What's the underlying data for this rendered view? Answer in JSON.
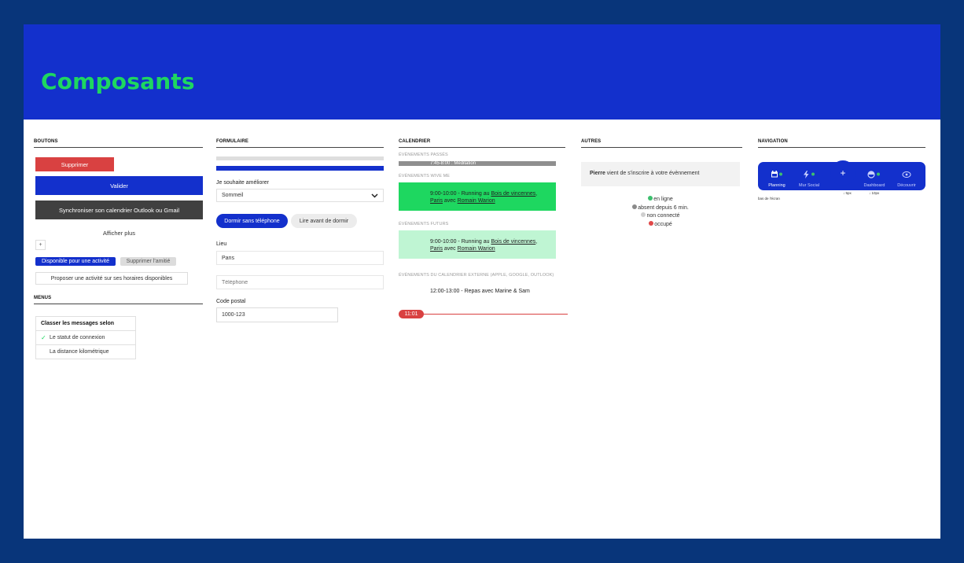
{
  "header": {
    "title": "Composants"
  },
  "colors": {
    "background": "#08357a",
    "hero": "#1330cc",
    "accent_green": "#1ed760",
    "danger": "#d94141",
    "primary": "#1330cc",
    "dark": "#404040"
  },
  "boutons": {
    "title": "BOUTONS",
    "delete": "Supprimer",
    "validate": "Valider",
    "sync": "Synchroniser son calendrier Outlook ou Gmail",
    "show_more": "Afficher plus",
    "plus": "+",
    "tag_available": "Disponible pour une activité",
    "tag_remove_friend": "Supprimer l'amitié",
    "propose": "Proposer une activité sur ses horaires disponibles"
  },
  "menus": {
    "title": "MENUS",
    "header": "Classer les messages selon",
    "items": [
      {
        "label": "Le statut de connexion",
        "checked": true
      },
      {
        "label": "La distance kilométrique",
        "checked": false
      }
    ]
  },
  "formulaire": {
    "title": "FORMULAIRE",
    "select_label": "Je souhaite améliorer",
    "select_value": "Sommeil",
    "pill_active": "Dormir sans téléphone",
    "pill_inactive": "Lire avant de dormir",
    "lieu_label": "Lieu",
    "lieu_value": "Paris",
    "phone_placeholder": "Téléphone",
    "postal_label": "Code postal",
    "postal_value": "1000-123",
    "progress": 1.0
  },
  "calendrier": {
    "title": "CALENDRIER",
    "past_label": "ÉVÉNEMENTS PASSÉS",
    "past_event": "7:45-8:00 : Méditation",
    "vive_label": "ÉVÉNEMENTS WIVE ME",
    "vive_event": {
      "time": "9:00-10:00 - Running au ",
      "place": "Bois de vincennes",
      "sep1": ",",
      "with": "Paris",
      "sep2": " avec ",
      "person": "Romain Warion"
    },
    "future_label": "ÉVÉNEMENTS FUTURS",
    "future_event": {
      "time": "9:00-10:00 - Running au ",
      "place": "Bois de vincennes",
      "sep1": ",",
      "with": "Paris",
      "sep2": " avec ",
      "person": "Romain Warion"
    },
    "external_label": "ÉVÉNEMENTS DU CALENDRIER EXTERNE (APPLE, GOOGLE, OUTLOOK)",
    "external_event": "12:00-13:00 - Repas avec Marine & Sam",
    "now": "11:01"
  },
  "autres": {
    "title": "AUTRES",
    "notif_name": "Pierre",
    "notif_text": " vient de s'inscrire à votre évènnement",
    "statuses": [
      {
        "label": "en ligne",
        "color": "#3dbf6e"
      },
      {
        "label": "absent depuis 6 min.",
        "color": "#8a8a8a"
      },
      {
        "label": "non connecté",
        "color": "#cfcfcf"
      },
      {
        "label": "occupé",
        "color": "#e04848"
      }
    ]
  },
  "navigation": {
    "title": "NAVIGATION",
    "items": [
      {
        "label": "Planning",
        "icon": "calendar-icon"
      },
      {
        "label": "Mur Social",
        "icon": "bolt-icon"
      },
      {
        "label": "Dashboard",
        "icon": "dashboard-icon"
      },
      {
        "label": "Découvrir",
        "icon": "eye-icon"
      }
    ],
    "fab": "+",
    "note_left": "bas de l'écran",
    "note_5px": "5px",
    "note_10px": "10px"
  }
}
